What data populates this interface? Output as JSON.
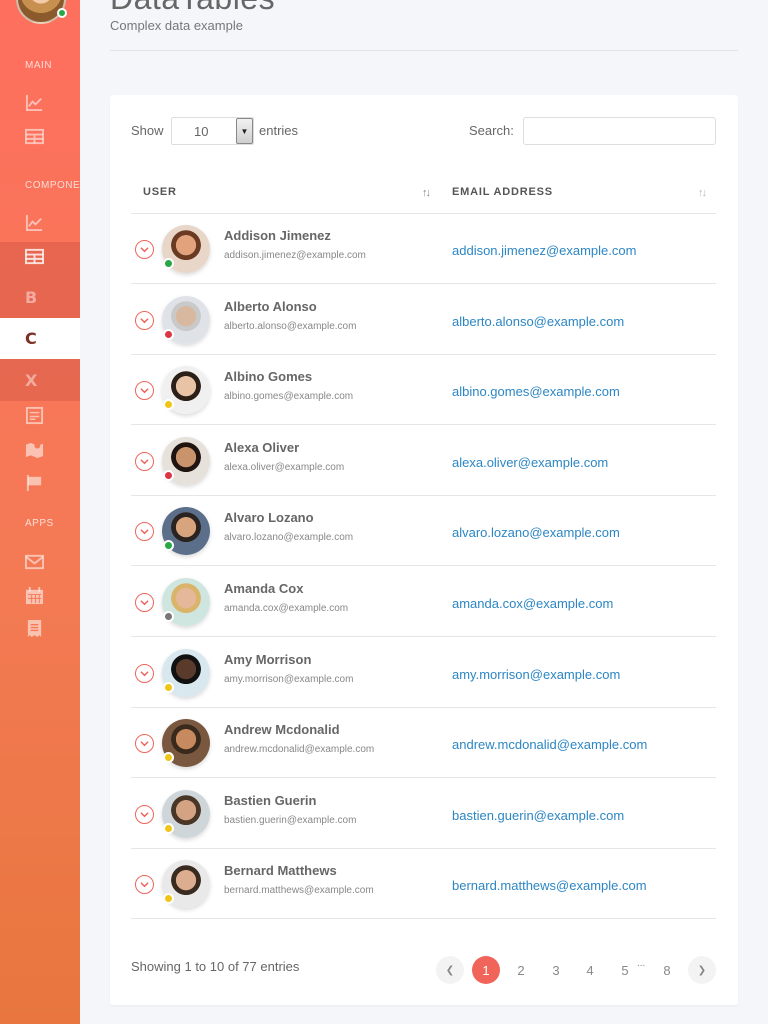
{
  "sidebar": {
    "section_main": "MAIN",
    "section_components": "COMPONENTS",
    "section_apps": "APPS",
    "items": [
      {
        "icon": "line-chart-icon"
      },
      {
        "icon": "table-icon"
      },
      {
        "icon": "line-chart-icon"
      },
      {
        "icon": "table-icon"
      },
      {
        "icon": "letter-b-icon",
        "letter": "B"
      },
      {
        "icon": "letter-c-icon",
        "letter": "C",
        "active": true
      },
      {
        "icon": "letter-x-icon",
        "letter": "X"
      },
      {
        "icon": "form-icon"
      },
      {
        "icon": "map-icon"
      },
      {
        "icon": "flag-icon"
      },
      {
        "icon": "envelope-icon"
      },
      {
        "icon": "calendar-icon"
      },
      {
        "icon": "invoice-icon"
      }
    ]
  },
  "header": {
    "title": "DataTables",
    "subtitle": "Complex data example"
  },
  "controls": {
    "show_label": "Show",
    "page_length": "10",
    "entries_label": "entries",
    "search_label": "Search:",
    "search_value": ""
  },
  "table": {
    "columns": [
      "USER",
      "EMAIL ADDRESS"
    ],
    "rows": [
      {
        "name": "Addison Jimenez",
        "sub": "addison.jimenez@example.com",
        "email": "addison.jimenez@example.com",
        "status": "online"
      },
      {
        "name": "Alberto Alonso",
        "sub": "alberto.alonso@example.com",
        "email": "alberto.alonso@example.com",
        "status": "busy"
      },
      {
        "name": "Albino Gomes",
        "sub": "albino.gomes@example.com",
        "email": "albino.gomes@example.com",
        "status": "away"
      },
      {
        "name": "Alexa Oliver",
        "sub": "alexa.oliver@example.com",
        "email": "alexa.oliver@example.com",
        "status": "busy"
      },
      {
        "name": "Alvaro Lozano",
        "sub": "alvaro.lozano@example.com",
        "email": "alvaro.lozano@example.com",
        "status": "online"
      },
      {
        "name": "Amanda Cox",
        "sub": "amanda.cox@example.com",
        "email": "amanda.cox@example.com",
        "status": "offline"
      },
      {
        "name": "Amy Morrison",
        "sub": "amy.morrison@example.com",
        "email": "amy.morrison@example.com",
        "status": "away"
      },
      {
        "name": "Andrew Mcdonalid",
        "sub": "andrew.mcdonalid@example.com",
        "email": "andrew.mcdonalid@example.com",
        "status": "away"
      },
      {
        "name": "Bastien Guerin",
        "sub": "bastien.guerin@example.com",
        "email": "bastien.guerin@example.com",
        "status": "away"
      },
      {
        "name": "Bernard Matthews",
        "sub": "bernard.matthews@example.com",
        "email": "bernard.matthews@example.com",
        "status": "away"
      }
    ]
  },
  "status_colors": {
    "online": "#28a745",
    "busy": "#dc3545",
    "away": "#f0c419",
    "offline": "#777777"
  },
  "footer": {
    "info": "Showing 1 to 10 of 77 entries",
    "pages": [
      "1",
      "2",
      "3",
      "4",
      "5",
      "8"
    ],
    "current_page": "1",
    "ellipsis": "..."
  },
  "colors": {
    "accent": "#f0645a",
    "link": "#2c86c4"
  }
}
